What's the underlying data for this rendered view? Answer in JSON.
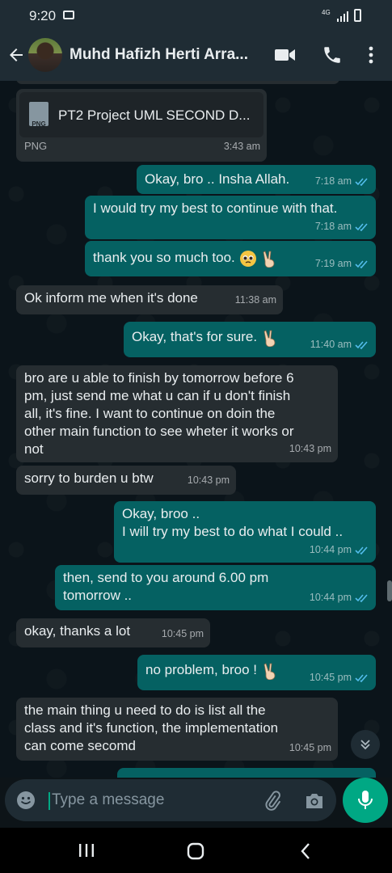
{
  "status_bar": {
    "time": "9:20",
    "network": "4G"
  },
  "header": {
    "contact_name": "Muhd Hafizh Herti Arra..."
  },
  "file_message": {
    "file_type_badge": "PNG",
    "file_name": "PT2 Project UML SECOND D...",
    "file_type": "PNG",
    "time": "3:43 am"
  },
  "messages": [
    {
      "direction": "out",
      "text": "Okay, bro .. Insha Allah.",
      "time": "7:18 am"
    },
    {
      "direction": "out",
      "text": "I would try my best to continue with that.",
      "time": "7:18 am"
    },
    {
      "direction": "out",
      "text": "thank you so much too.",
      "emoji": [
        "pleading-face",
        "victory-hand"
      ],
      "time": "7:19 am"
    },
    {
      "direction": "in",
      "text": "Ok inform me when it's done",
      "time": "11:38 am"
    },
    {
      "direction": "out",
      "text": "Okay, that's for sure.",
      "emoji": [
        "victory-hand"
      ],
      "time": "11:40 am"
    },
    {
      "direction": "in",
      "lines": [
        "bro are u able to finish by tomorrow before 6",
        "pm, just send me what u can if u don't finish",
        "all, it's fine. I want to continue on doin the",
        "other main function to see wheter it works or",
        "not"
      ],
      "time": "10:43 pm"
    },
    {
      "direction": "in",
      "text": "sorry to burden u btw",
      "time": "10:43 pm"
    },
    {
      "direction": "out",
      "lines": [
        "Okay, broo ..",
        "I will try my best to do what I could .."
      ],
      "time": "10:44 pm"
    },
    {
      "direction": "out",
      "lines": [
        "then, send to you around 6.00 pm",
        "tomorrow .."
      ],
      "time": "10:44 pm"
    },
    {
      "direction": "in",
      "text": "okay, thanks a lot",
      "time": "10:45 pm"
    },
    {
      "direction": "out",
      "text": "no problem, broo !",
      "emoji": [
        "victory-hand"
      ],
      "time": "10:45 pm"
    },
    {
      "direction": "in",
      "lines": [
        "the main thing u need to do is list all the",
        "class and it's function, the implementation",
        "can come secomd"
      ],
      "time": "10:45 pm"
    }
  ],
  "input": {
    "placeholder": "Type a message"
  },
  "colors": {
    "header": "#1f2c34",
    "chat_bg": "#0b141a",
    "incoming": "#262d31",
    "outgoing": "#056162",
    "accent": "#00a884",
    "read_ticks": "#53bdeb"
  },
  "icons": [
    "back-arrow-icon",
    "video-call-icon",
    "voice-call-icon",
    "menu-icon",
    "emoji-icon",
    "attach-icon",
    "camera-icon",
    "mic-icon",
    "scroll-down-icon"
  ]
}
